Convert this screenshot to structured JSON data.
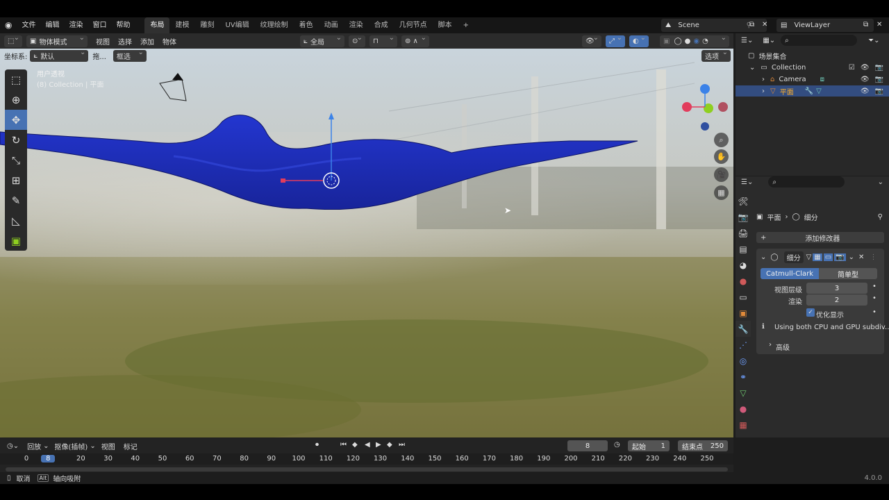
{
  "menu": {
    "items": [
      "文件",
      "编辑",
      "渲染",
      "窗口",
      "帮助"
    ],
    "workspaces": [
      "布局",
      "建模",
      "雕刻",
      "UV编辑",
      "纹理绘制",
      "着色",
      "动画",
      "渲染",
      "合成",
      "几何节点",
      "脚本"
    ],
    "active_workspace": "布局",
    "add_tab": "+",
    "scene": "Scene",
    "view_layer": "ViewLayer"
  },
  "viewport_header": {
    "mode": "物体模式",
    "menus": [
      "视图",
      "选择",
      "添加",
      "物体"
    ],
    "transform_orientation": "全局",
    "coord_label": "坐标系:",
    "coord_value": "默认",
    "drag_label": "拖...",
    "select_mode": "框选",
    "options": "选项"
  },
  "viewport": {
    "view_name": "用户透视",
    "collection_info": "(8) Collection | 平面",
    "gizmo": {
      "x": "X",
      "y": "Y",
      "z": "Z",
      "x_color": "#e23c5c",
      "y_color": "#8fcf20",
      "z_color": "#3b82e8"
    },
    "mesh_color": "#1f2fc8"
  },
  "outliner": {
    "root": "场景集合",
    "items": [
      {
        "name": "Collection",
        "icon": "collection-icon"
      },
      {
        "name": "Camera",
        "icon": "camera-icon"
      },
      {
        "name": "平面",
        "icon": "mesh-icon",
        "selected": true
      }
    ]
  },
  "properties": {
    "breadcrumb_object": "平面",
    "breadcrumb_modifier": "细分",
    "add_modifier": "添加修改器",
    "modifier_name": "细分",
    "type_catmull": "Catmull-Clark",
    "type_simple": "简单型",
    "view_level_label": "视图层级",
    "view_level_value": "3",
    "render_label": "渲染",
    "render_value": "2",
    "optimize_label": "优化显示",
    "optimize_checked": true,
    "info_text": "Using both CPU and GPU subdiv...",
    "advanced": "高级"
  },
  "timeline": {
    "playback": "回放",
    "keying": "抠像(插帧)",
    "view": "视图",
    "marker": "标记",
    "current_frame": "8",
    "start_label": "起始",
    "start_value": "1",
    "end_label": "结束点",
    "end_value": "250",
    "ruler": [
      "0",
      "8",
      "20",
      "30",
      "40",
      "50",
      "60",
      "70",
      "80",
      "90",
      "100",
      "110",
      "120",
      "130",
      "140",
      "150",
      "160",
      "170",
      "180",
      "190",
      "200",
      "210",
      "220",
      "230",
      "240",
      "250"
    ]
  },
  "status": {
    "cancel": "取消",
    "alt_key": "Alt",
    "axis_snap": "轴向吸附",
    "version": "4.0.0"
  }
}
